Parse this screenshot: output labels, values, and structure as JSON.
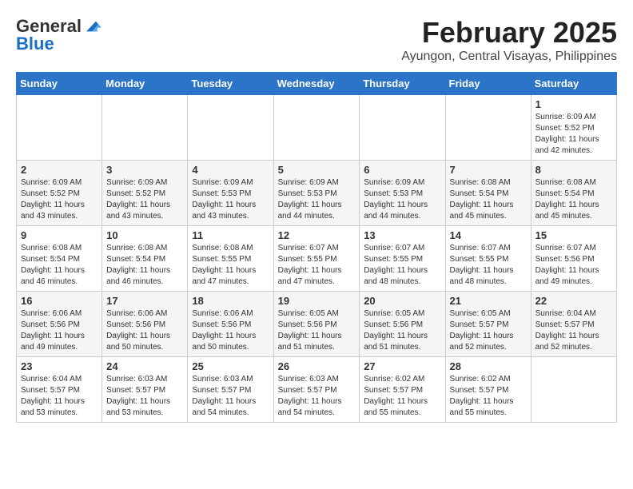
{
  "header": {
    "logo_general": "General",
    "logo_blue": "Blue",
    "month_title": "February 2025",
    "location": "Ayungon, Central Visayas, Philippines"
  },
  "weekdays": [
    "Sunday",
    "Monday",
    "Tuesday",
    "Wednesday",
    "Thursday",
    "Friday",
    "Saturday"
  ],
  "weeks": [
    [
      {
        "day": "",
        "info": ""
      },
      {
        "day": "",
        "info": ""
      },
      {
        "day": "",
        "info": ""
      },
      {
        "day": "",
        "info": ""
      },
      {
        "day": "",
        "info": ""
      },
      {
        "day": "",
        "info": ""
      },
      {
        "day": "1",
        "info": "Sunrise: 6:09 AM\nSunset: 5:52 PM\nDaylight: 11 hours\nand 42 minutes."
      }
    ],
    [
      {
        "day": "2",
        "info": "Sunrise: 6:09 AM\nSunset: 5:52 PM\nDaylight: 11 hours\nand 43 minutes."
      },
      {
        "day": "3",
        "info": "Sunrise: 6:09 AM\nSunset: 5:52 PM\nDaylight: 11 hours\nand 43 minutes."
      },
      {
        "day": "4",
        "info": "Sunrise: 6:09 AM\nSunset: 5:53 PM\nDaylight: 11 hours\nand 43 minutes."
      },
      {
        "day": "5",
        "info": "Sunrise: 6:09 AM\nSunset: 5:53 PM\nDaylight: 11 hours\nand 44 minutes."
      },
      {
        "day": "6",
        "info": "Sunrise: 6:09 AM\nSunset: 5:53 PM\nDaylight: 11 hours\nand 44 minutes."
      },
      {
        "day": "7",
        "info": "Sunrise: 6:08 AM\nSunset: 5:54 PM\nDaylight: 11 hours\nand 45 minutes."
      },
      {
        "day": "8",
        "info": "Sunrise: 6:08 AM\nSunset: 5:54 PM\nDaylight: 11 hours\nand 45 minutes."
      }
    ],
    [
      {
        "day": "9",
        "info": "Sunrise: 6:08 AM\nSunset: 5:54 PM\nDaylight: 11 hours\nand 46 minutes."
      },
      {
        "day": "10",
        "info": "Sunrise: 6:08 AM\nSunset: 5:54 PM\nDaylight: 11 hours\nand 46 minutes."
      },
      {
        "day": "11",
        "info": "Sunrise: 6:08 AM\nSunset: 5:55 PM\nDaylight: 11 hours\nand 47 minutes."
      },
      {
        "day": "12",
        "info": "Sunrise: 6:07 AM\nSunset: 5:55 PM\nDaylight: 11 hours\nand 47 minutes."
      },
      {
        "day": "13",
        "info": "Sunrise: 6:07 AM\nSunset: 5:55 PM\nDaylight: 11 hours\nand 48 minutes."
      },
      {
        "day": "14",
        "info": "Sunrise: 6:07 AM\nSunset: 5:55 PM\nDaylight: 11 hours\nand 48 minutes."
      },
      {
        "day": "15",
        "info": "Sunrise: 6:07 AM\nSunset: 5:56 PM\nDaylight: 11 hours\nand 49 minutes."
      }
    ],
    [
      {
        "day": "16",
        "info": "Sunrise: 6:06 AM\nSunset: 5:56 PM\nDaylight: 11 hours\nand 49 minutes."
      },
      {
        "day": "17",
        "info": "Sunrise: 6:06 AM\nSunset: 5:56 PM\nDaylight: 11 hours\nand 50 minutes."
      },
      {
        "day": "18",
        "info": "Sunrise: 6:06 AM\nSunset: 5:56 PM\nDaylight: 11 hours\nand 50 minutes."
      },
      {
        "day": "19",
        "info": "Sunrise: 6:05 AM\nSunset: 5:56 PM\nDaylight: 11 hours\nand 51 minutes."
      },
      {
        "day": "20",
        "info": "Sunrise: 6:05 AM\nSunset: 5:56 PM\nDaylight: 11 hours\nand 51 minutes."
      },
      {
        "day": "21",
        "info": "Sunrise: 6:05 AM\nSunset: 5:57 PM\nDaylight: 11 hours\nand 52 minutes."
      },
      {
        "day": "22",
        "info": "Sunrise: 6:04 AM\nSunset: 5:57 PM\nDaylight: 11 hours\nand 52 minutes."
      }
    ],
    [
      {
        "day": "23",
        "info": "Sunrise: 6:04 AM\nSunset: 5:57 PM\nDaylight: 11 hours\nand 53 minutes."
      },
      {
        "day": "24",
        "info": "Sunrise: 6:03 AM\nSunset: 5:57 PM\nDaylight: 11 hours\nand 53 minutes."
      },
      {
        "day": "25",
        "info": "Sunrise: 6:03 AM\nSunset: 5:57 PM\nDaylight: 11 hours\nand 54 minutes."
      },
      {
        "day": "26",
        "info": "Sunrise: 6:03 AM\nSunset: 5:57 PM\nDaylight: 11 hours\nand 54 minutes."
      },
      {
        "day": "27",
        "info": "Sunrise: 6:02 AM\nSunset: 5:57 PM\nDaylight: 11 hours\nand 55 minutes."
      },
      {
        "day": "28",
        "info": "Sunrise: 6:02 AM\nSunset: 5:57 PM\nDaylight: 11 hours\nand 55 minutes."
      },
      {
        "day": "",
        "info": ""
      }
    ]
  ]
}
